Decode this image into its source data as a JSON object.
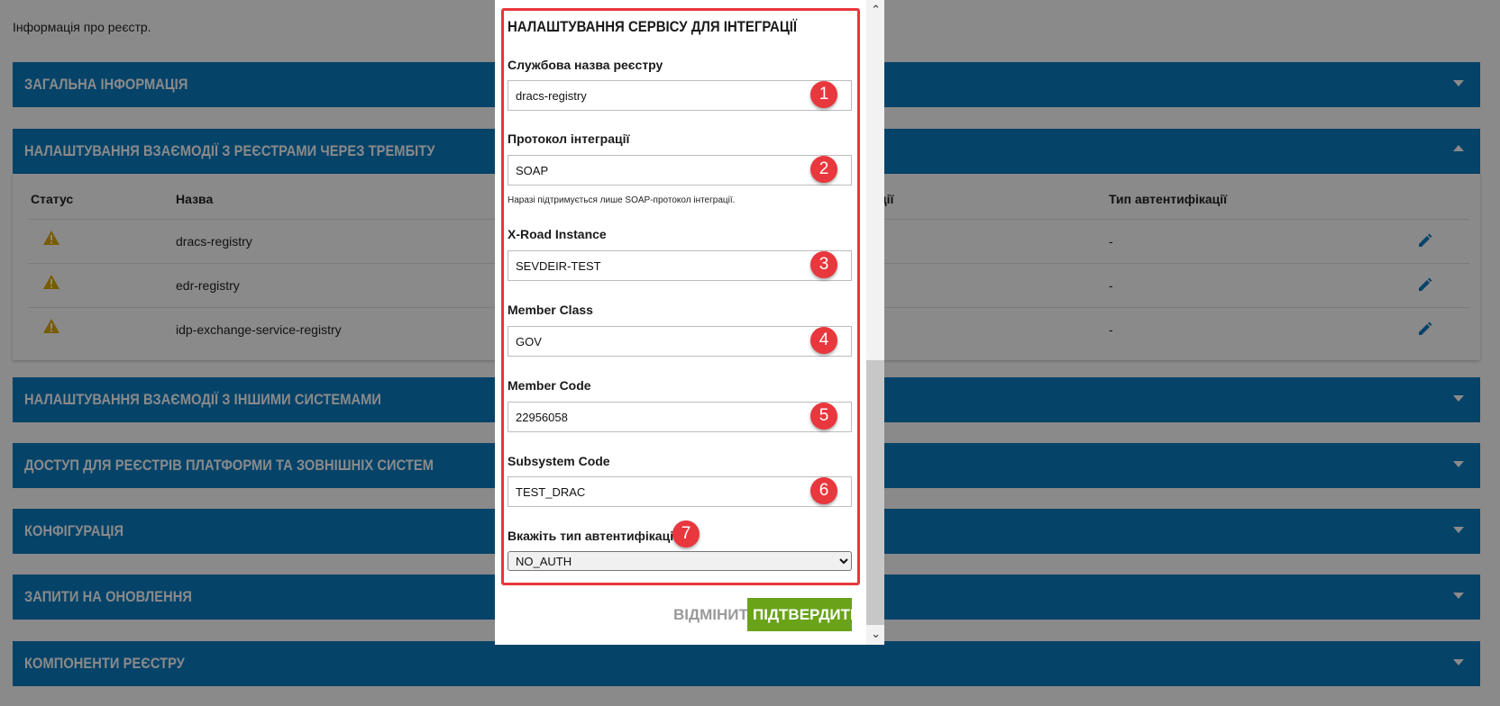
{
  "page": {
    "info": "Інформація про реєстр."
  },
  "panels": {
    "general": "ЗАГАЛЬНА ІНФОРМАЦІЯ",
    "trembita": "НАЛАШТУВАННЯ ВЗАЄМОДІЇ З РЕЄСТРАМИ ЧЕРЕЗ ТРЕМБІТУ",
    "other_systems": "НАЛАШТУВАННЯ ВЗАЄМОДІЇ З ІНШИМИ СИСТЕМАМИ",
    "access": "ДОСТУП ДЛЯ РЕЄСТРІВ ПЛАТФОРМИ ТА ЗОВНІШНІХ СИСТЕМ",
    "configuration": "КОНФІГУРАЦІЯ",
    "update_requests": "ЗАПИТИ НА ОНОВЛЕННЯ",
    "components": "КОМПОНЕНТИ РЕЄСТРУ"
  },
  "table": {
    "headers": {
      "status": "Статус",
      "name": "Назва",
      "protocol_tail": "ції",
      "auth_type": "Тип автентифікації"
    },
    "rows": [
      {
        "name": "dracs-registry",
        "auth": "-"
      },
      {
        "name": "edr-registry",
        "auth": "-"
      },
      {
        "name": "idp-exchange-service-registry",
        "auth": "-"
      }
    ]
  },
  "modal": {
    "title": "НАЛАШТУВАННЯ СЕРВІСУ ДЛЯ ІНТЕГРАЦІЇ",
    "fields": {
      "service_name": {
        "label": "Службова назва реєстру",
        "value": "dracs-registry",
        "badge": "1"
      },
      "protocol": {
        "label": "Протокол інтеграції",
        "value": "SOAP",
        "badge": "2",
        "hint": "Наразі підтримується лише SOAP-протокол інтеграції."
      },
      "xroad_instance": {
        "label": "X-Road Instance",
        "value": "SEVDEIR-TEST",
        "badge": "3"
      },
      "member_class": {
        "label": "Member Class",
        "value": "GOV",
        "badge": "4"
      },
      "member_code": {
        "label": "Member Code",
        "value": "22956058",
        "badge": "5"
      },
      "subsystem_code": {
        "label": "Subsystem Code",
        "value": "TEST_DRAC",
        "badge": "6"
      },
      "auth_type": {
        "label": "Вкажіть тип автентифікації",
        "value": "NO_AUTH",
        "badge": "7"
      }
    },
    "cancel_label": "ВІДМІНИТИ",
    "confirm_label": "ПІДТВЕРДИТИ"
  },
  "colors": {
    "panel": "#0a7cc2",
    "confirm": "#6aa31a",
    "highlight": "#e8373d",
    "warning": "#e0a800",
    "pencil": "#0a7cc2"
  }
}
